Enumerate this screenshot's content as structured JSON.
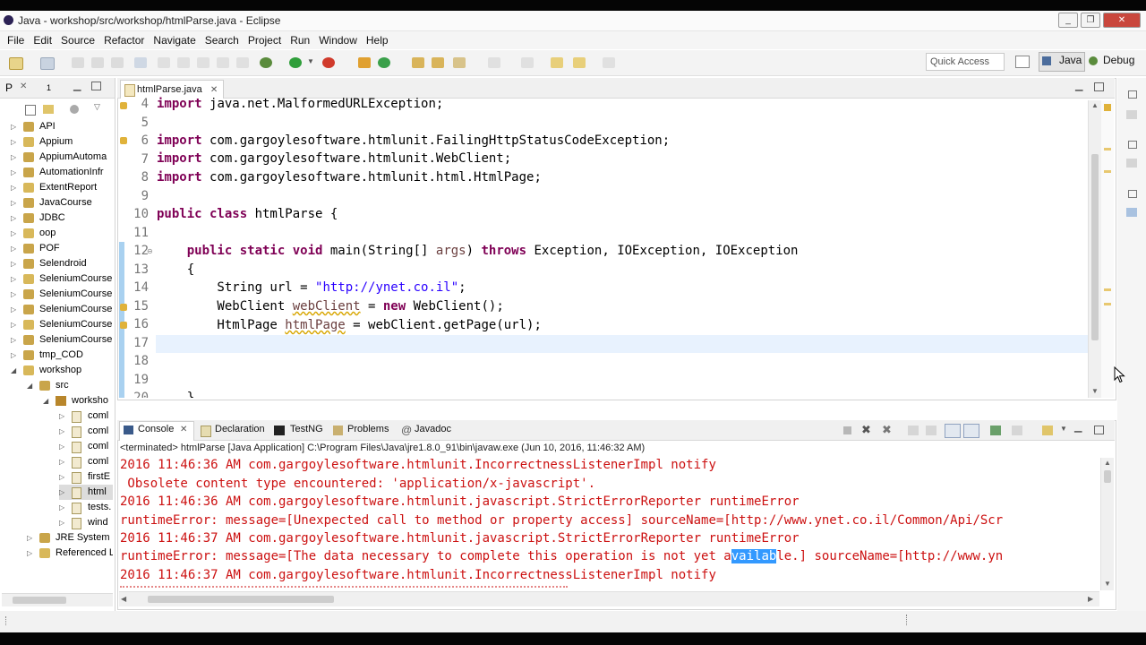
{
  "window": {
    "title": "Java - workshop/src/workshop/htmlParse.java - Eclipse"
  },
  "menu": [
    "File",
    "Edit",
    "Source",
    "Refactor",
    "Navigate",
    "Search",
    "Project",
    "Run",
    "Window",
    "Help"
  ],
  "toolbar": {
    "quick_access": "Quick Access",
    "perspectives": [
      "Java",
      "Debug"
    ]
  },
  "package_explorer": {
    "tabs": [
      "P",
      "1"
    ],
    "items": [
      {
        "label": "API",
        "level": 0
      },
      {
        "label": "Appium",
        "level": 0
      },
      {
        "label": "AppiumAutoma",
        "level": 0
      },
      {
        "label": "AutomationInfr",
        "level": 0
      },
      {
        "label": "ExtentReport",
        "level": 0
      },
      {
        "label": "JavaCourse",
        "level": 0
      },
      {
        "label": "JDBC",
        "level": 0
      },
      {
        "label": "oop",
        "level": 0
      },
      {
        "label": "POF",
        "level": 0
      },
      {
        "label": "Selendroid",
        "level": 0
      },
      {
        "label": "SeleniumCourse",
        "level": 0
      },
      {
        "label": "SeleniumCourse",
        "level": 0
      },
      {
        "label": "SeleniumCourse",
        "level": 0
      },
      {
        "label": "SeleniumCourse",
        "level": 0
      },
      {
        "label": "SeleniumCourse",
        "level": 0
      },
      {
        "label": "tmp_COD",
        "level": 0
      },
      {
        "label": "workshop",
        "level": 0
      },
      {
        "label": "src",
        "level": 1
      },
      {
        "label": "worksho",
        "level": 2
      },
      {
        "label": "coml",
        "level": 3
      },
      {
        "label": "coml",
        "level": 3
      },
      {
        "label": "coml",
        "level": 3
      },
      {
        "label": "coml",
        "level": 3
      },
      {
        "label": "firstE",
        "level": 3
      },
      {
        "label": "html",
        "level": 3
      },
      {
        "label": "tests.",
        "level": 3
      },
      {
        "label": "wind",
        "level": 3
      },
      {
        "label": "JRE System L",
        "level": 1
      },
      {
        "label": "Referenced L",
        "level": 1
      }
    ]
  },
  "editor": {
    "tab": "htmlParse.java",
    "line_numbers": [
      "4",
      "5",
      "6",
      "7",
      "8",
      "9",
      "10",
      "11",
      "12",
      "13",
      "14",
      "15",
      "16",
      "17",
      "18",
      "19",
      "20"
    ],
    "lines": {
      "l4a": "import ",
      "l4b": "java.net.MalformedURLException;",
      "l6a": "import ",
      "l6b": "com.gargoylesoftware.htmlunit.FailingHttpStatusCodeException;",
      "l7a": "import ",
      "l7b": "com.gargoylesoftware.htmlunit.WebClient;",
      "l8a": "import ",
      "l8b": "com.gargoylesoftware.htmlunit.html.HtmlPage;",
      "l10a": "public class ",
      "l10b": "htmlParse {",
      "l12a": "    public static void ",
      "l12b": "main(String[] ",
      "l12c": "args",
      "l12d": ") ",
      "l12e": "throws",
      "l12f": " Exception, IOException, IOException",
      "l13": "    {",
      "l14a": "        String url = ",
      "l14b": "\"http://ynet.co.il\"",
      "l14c": ";",
      "l15a": "        WebClient ",
      "l15b": "webClient",
      "l15c": " = ",
      "l15d": "new",
      "l15e": " WebClient();",
      "l16a": "        HtmlPage ",
      "l16b": "htmlPage",
      "l16c": " = webClient.getPage(url);",
      "l20": "    }"
    }
  },
  "console": {
    "tabs": [
      "Console",
      "Declaration",
      "TestNG",
      "Problems",
      "Javadoc"
    ],
    "terminated": "<terminated> htmlParse [Java Application] C:\\Program Files\\Java\\jre1.8.0_91\\bin\\javaw.exe (Jun 10, 2016, 11:46:32 AM)",
    "lines": [
      "2016 11:46:36 AM com.gargoylesoftware.htmlunit.IncorrectnessListenerImpl notify",
      " Obsolete content type encountered: 'application/x-javascript'.",
      "2016 11:46:36 AM com.gargoylesoftware.htmlunit.javascript.StrictErrorReporter runtimeError",
      "runtimeError: message=[Unexpected call to method or property access] sourceName=[http://www.ynet.co.il/Common/Api/Scr",
      "2016 11:46:37 AM com.gargoylesoftware.htmlunit.javascript.StrictErrorReporter runtimeError"
    ],
    "line6a": "runtimeError: message=[The data necessary to complete this operation is not yet a",
    "line6sel": "vailab",
    "line6b": "le.] sourceName=[http://www.yn",
    "line7": "2016 11:46:37 AM com.gargoylesoftware.htmlunit.IncorrectnessListenerImpl notify"
  },
  "colors": {
    "keyword": "#7f0055",
    "string": "#2a00ff",
    "console_error": "#cc1111",
    "selection": "#3399ff",
    "current_line": "#e8f2fe"
  }
}
